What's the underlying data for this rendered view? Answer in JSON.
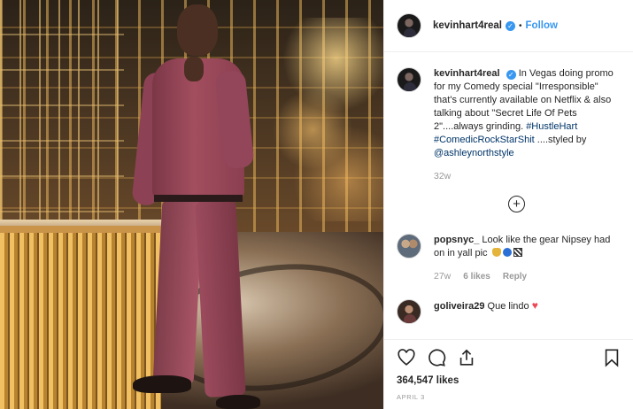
{
  "post": {
    "image_alt": "Man in a burgundy suit standing in a golden lobby"
  },
  "header": {
    "username": "kevinhart4real",
    "separator": "•",
    "follow_label": "Follow"
  },
  "caption": {
    "author": "kevinhart4real",
    "text_1": "In Vegas doing promo for my Comedy special \"Irresponsible\" that's currently available on Netflix & also talking about \"Secret Life Of Pets 2\"....always grinding. ",
    "hashtag_1": "#HustleHart",
    "hashtag_2": "#ComedicRockStarShit",
    "text_2": " ....styled by ",
    "mention": "@ashleynorthstyle",
    "age": "32w"
  },
  "load_more": {
    "icon": "plus-circle-icon"
  },
  "comments": [
    {
      "author": "popsnyc_",
      "text": "Look like the gear Nipsey had on in yall pic",
      "age": "27w",
      "likes": "6 likes",
      "reply_label": "Reply"
    },
    {
      "author": "goliveira29",
      "text": "Que lindo"
    }
  ],
  "actions": {
    "like_icon": "heart-icon",
    "comment_icon": "comment-icon",
    "share_icon": "share-icon",
    "save_icon": "bookmark-icon"
  },
  "likes_count": "364,547 likes",
  "date": "APRIL 3",
  "colors": {
    "link_blue": "#3897f0",
    "hashtag": "#003569",
    "meta_gray": "#999999",
    "heart_red": "#ed4956"
  }
}
